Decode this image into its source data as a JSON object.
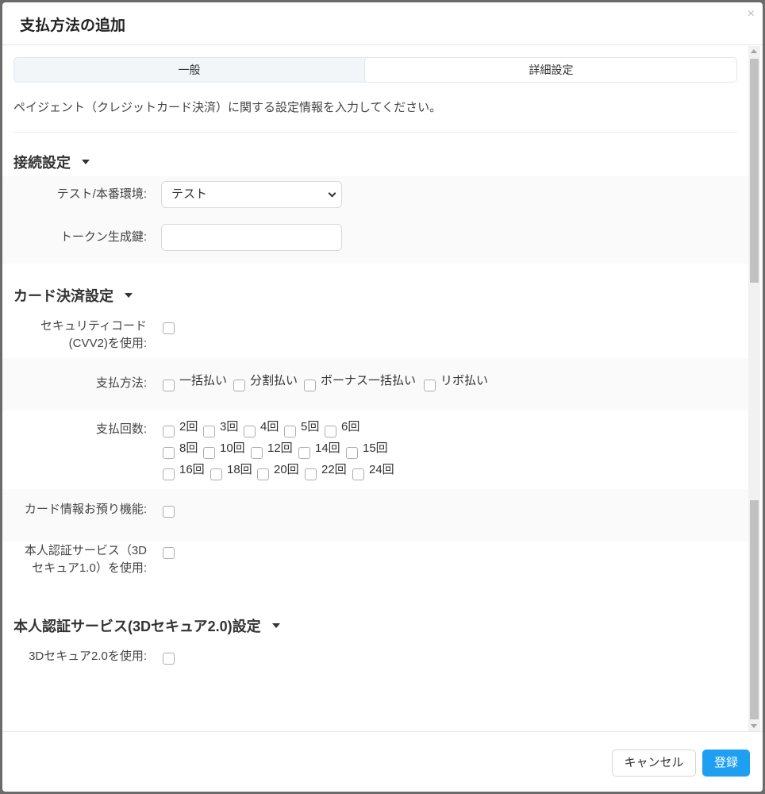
{
  "dialog": {
    "title": "支払方法の追加",
    "close_icon": "×"
  },
  "tabs": [
    {
      "label": "一般",
      "active": false
    },
    {
      "label": "詳細設定",
      "active": true
    }
  ],
  "description": "ペイジェント（クレジットカード決済）に関する設定情報を入力してください。",
  "connection": {
    "title": "接続設定",
    "env_label": "テスト/本番環境:",
    "env_value": "テスト",
    "token_label": "トークン生成鍵:",
    "token_value": ""
  },
  "card": {
    "title": "カード決済設定",
    "cvv_label_1": "セキュリティコード",
    "cvv_label_2": "(CVV2)を使用:",
    "payment_method_label": "支払方法:",
    "payment_methods": [
      "一括払い",
      "分割払い",
      "ボーナス一括払い",
      "リボ払い"
    ],
    "installments_label": "支払回数:",
    "installments": [
      "2回",
      "3回",
      "4回",
      "5回",
      "6回",
      "8回",
      "10回",
      "12回",
      "14回",
      "15回",
      "16回",
      "18回",
      "20回",
      "22回",
      "24回"
    ],
    "card_storage_label": "カード情報お預り機能:",
    "secure10_label_1": "本人認証サービス（3D",
    "secure10_label_2": "セキュア1.0）を使用:"
  },
  "secure2": {
    "title": "本人認証サービス(3Dセキュア2.0)設定",
    "use_label": "3Dセキュア2.0を使用:"
  },
  "footer": {
    "cancel_label": "キャンセル",
    "save_label": "登録",
    "save_color": "#1e9ff2"
  }
}
